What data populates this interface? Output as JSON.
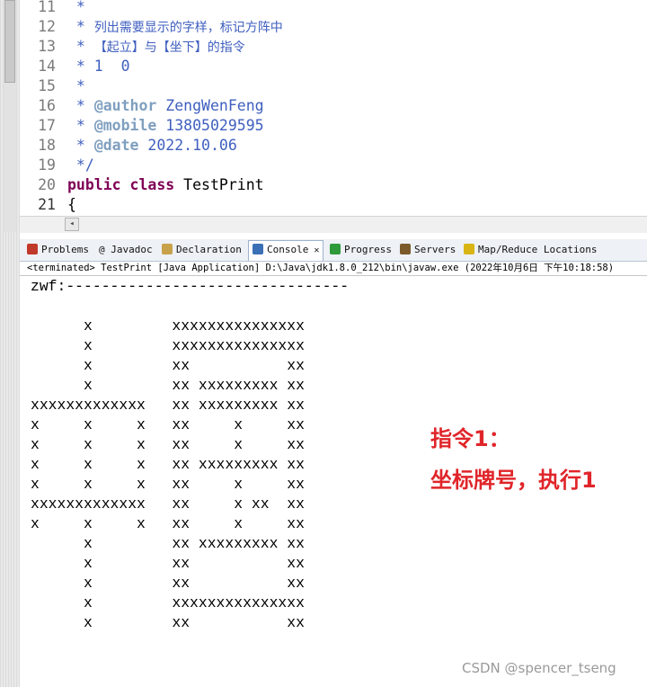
{
  "editor": {
    "lines": [
      {
        "num": "11",
        "parts": [
          {
            "cls": "cm",
            "text": " *"
          }
        ]
      },
      {
        "num": "12",
        "parts": [
          {
            "cls": "cm",
            "text": " * "
          },
          {
            "cls": "cmj",
            "text": "列出需要显示的字样，标记方阵中"
          }
        ]
      },
      {
        "num": "13",
        "parts": [
          {
            "cls": "cm",
            "text": " * "
          },
          {
            "cls": "cmj",
            "text": "【起立】与【坐下】的指令"
          }
        ]
      },
      {
        "num": "14",
        "parts": [
          {
            "cls": "cm",
            "text": " * 1  0"
          }
        ]
      },
      {
        "num": "15",
        "parts": [
          {
            "cls": "cm",
            "text": " *"
          }
        ]
      },
      {
        "num": "16",
        "parts": [
          {
            "cls": "cm",
            "text": " * "
          },
          {
            "cls": "tag",
            "text": "@author"
          },
          {
            "cls": "cm",
            "text": " ZengWenFeng"
          }
        ]
      },
      {
        "num": "17",
        "parts": [
          {
            "cls": "cm",
            "text": " * "
          },
          {
            "cls": "tag",
            "text": "@mobile"
          },
          {
            "cls": "cm",
            "text": " 13805029595"
          }
        ]
      },
      {
        "num": "18",
        "parts": [
          {
            "cls": "cm",
            "text": " * "
          },
          {
            "cls": "tag",
            "text": "@date"
          },
          {
            "cls": "cm",
            "text": " 2022.10.06"
          }
        ]
      },
      {
        "num": "19",
        "parts": [
          {
            "cls": "cm",
            "text": " */"
          }
        ]
      },
      {
        "num": "20",
        "parts": [
          {
            "cls": "kw",
            "text": "public"
          },
          {
            "cls": "plain",
            "text": " "
          },
          {
            "cls": "kw",
            "text": "class"
          },
          {
            "cls": "plain",
            "text": " TestPrint"
          }
        ]
      },
      {
        "num": "21",
        "parts": [
          {
            "cls": "plain",
            "text": "{"
          }
        ]
      }
    ],
    "scroll_left_arrow": "◂"
  },
  "tabs": [
    {
      "label": "Problems",
      "icon": "problems-icon",
      "color": "#c0392b"
    },
    {
      "label": "@ Javadoc",
      "icon": "javadoc-icon",
      "color": ""
    },
    {
      "label": "Declaration",
      "icon": "declaration-icon",
      "color": "#c8a24a"
    },
    {
      "label": "Console",
      "icon": "console-icon",
      "color": "#3b6fb6",
      "close": "✕"
    },
    {
      "label": "Progress",
      "icon": "progress-icon",
      "color": "#2e9a3a"
    },
    {
      "label": "Servers",
      "icon": "servers-icon",
      "color": "#7b5a2b"
    },
    {
      "label": "Map/Reduce Locations",
      "icon": "mapreduce-icon",
      "color": "#d8b515"
    }
  ],
  "status_line": "<terminated> TestPrint [Java Application] D:\\Java\\jdk1.8.0_212\\bin\\javaw.exe (2022年10月6日 下午10:18:58)",
  "console": {
    "lines": [
      "zwf:--------------------------------",
      "",
      "      x         xxxxxxxxxxxxxxx",
      "      x         xxxxxxxxxxxxxxx",
      "      x         xx           xx",
      "      x         xx xxxxxxxxx xx",
      "xxxxxxxxxxxxx   xx xxxxxxxxx xx",
      "x     x     x   xx     x     xx",
      "x     x     x   xx     x     xx",
      "x     x     x   xx xxxxxxxxx xx",
      "x     x     x   xx     x     xx",
      "xxxxxxxxxxxxx   xx     x xx  xx",
      "x     x     x   xx     x     xx",
      "      x         xx xxxxxxxxx xx",
      "      x         xx           xx",
      "      x         xx           xx",
      "      x         xxxxxxxxxxxxxxx",
      "      x         xx           xx"
    ]
  },
  "annotation": {
    "line1": "指令1：",
    "line2": "坐标牌号，执行1",
    "color": "#e0252a"
  },
  "watermark": "CSDN @spencer_tseng"
}
